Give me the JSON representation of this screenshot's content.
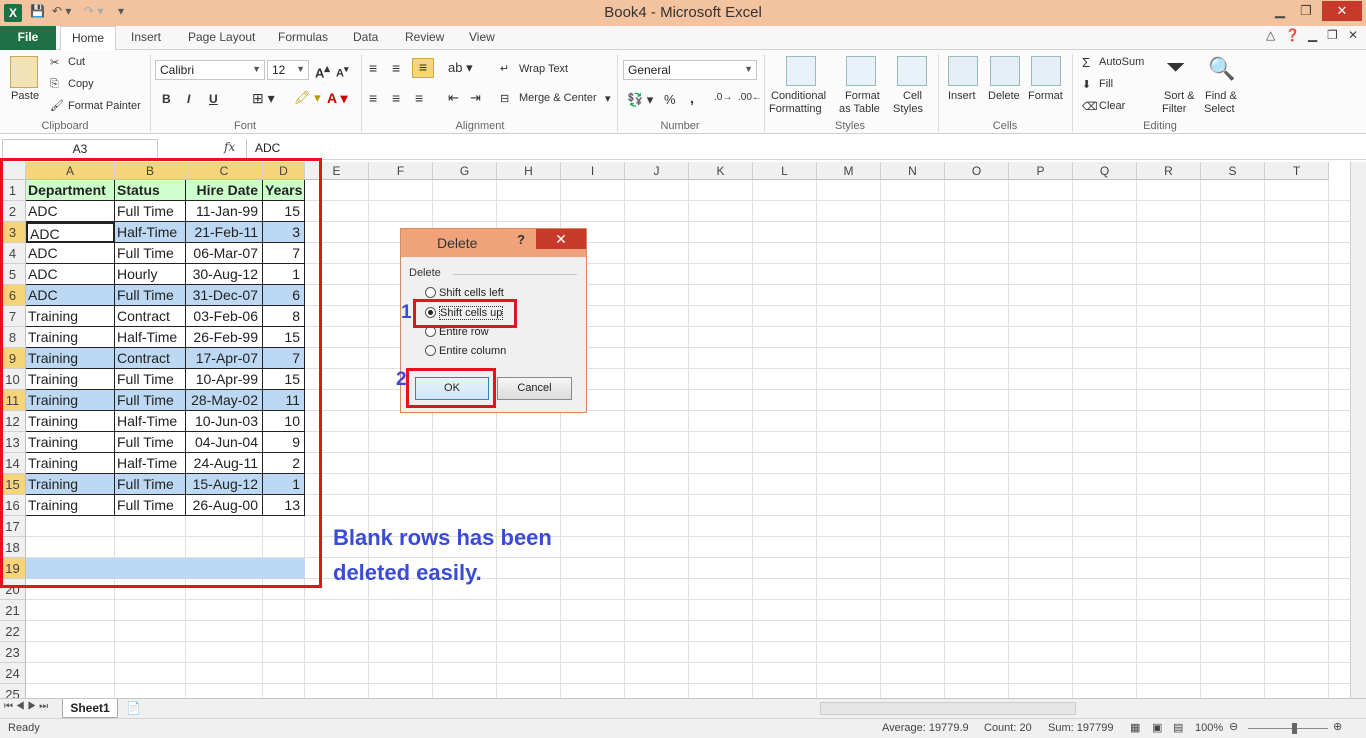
{
  "window": {
    "title": "Book4 -  Microsoft Excel"
  },
  "tabs": [
    "File",
    "Home",
    "Insert",
    "Page Layout",
    "Formulas",
    "Data",
    "Review",
    "View"
  ],
  "ribbon": {
    "clipboard": {
      "paste": "Paste",
      "cut": "Cut",
      "copy": "Copy",
      "format_painter": "Format Painter",
      "label": "Clipboard"
    },
    "font": {
      "name": "Calibri",
      "size": "12",
      "bold": "B",
      "italic": "I",
      "underline": "U",
      "label": "Font"
    },
    "alignment": {
      "wrap": "Wrap Text",
      "merge": "Merge & Center",
      "label": "Alignment"
    },
    "number": {
      "format": "General",
      "percent": "%",
      "comma": ",",
      "label": "Number"
    },
    "styles": {
      "conditional": "Conditional",
      "conditional2": "Formatting",
      "format_table": "Format",
      "format_table2": "as Table",
      "cell_styles": "Cell",
      "cell_styles2": "Styles",
      "label": "Styles"
    },
    "cells": {
      "insert": "Insert",
      "delete": "Delete",
      "format": "Format",
      "label": "Cells"
    },
    "editing": {
      "autosum": "AutoSum",
      "fill": "Fill",
      "clear": "Clear",
      "sort": "Sort &",
      "sort2": "Filter",
      "find": "Find &",
      "find2": "Select",
      "label": "Editing"
    }
  },
  "formula_bar": {
    "name_box": "A3",
    "fx": "fx",
    "content": "ADC"
  },
  "columns": [
    "A",
    "B",
    "C",
    "D",
    "E",
    "F",
    "G",
    "H",
    "I",
    "J",
    "K",
    "L",
    "M",
    "N",
    "O",
    "P",
    "Q",
    "R",
    "S",
    "T"
  ],
  "rows": [
    "1",
    "2",
    "3",
    "4",
    "5",
    "6",
    "7",
    "8",
    "9",
    "10",
    "11",
    "12",
    "13",
    "14",
    "15",
    "16",
    "17",
    "18",
    "19",
    "20",
    "21",
    "22",
    "23",
    "24",
    "25"
  ],
  "table": {
    "headers": [
      "Department",
      "Status",
      "Hire Date",
      "Years"
    ],
    "rows": [
      [
        "ADC",
        "Full Time",
        "11-Jan-99",
        "15"
      ],
      [
        "ADC",
        "Half-Time",
        "21-Feb-11",
        "3"
      ],
      [
        "ADC",
        "Full Time",
        "06-Mar-07",
        "7"
      ],
      [
        "ADC",
        "Hourly",
        "30-Aug-12",
        "1"
      ],
      [
        "ADC",
        "Full Time",
        "31-Dec-07",
        "6"
      ],
      [
        "Training",
        "Contract",
        "03-Feb-06",
        "8"
      ],
      [
        "Training",
        "Half-Time",
        "26-Feb-99",
        "15"
      ],
      [
        "Training",
        "Contract",
        "17-Apr-07",
        "7"
      ],
      [
        "Training",
        "Full Time",
        "10-Apr-99",
        "15"
      ],
      [
        "Training",
        "Full Time",
        "28-May-02",
        "11"
      ],
      [
        "Training",
        "Half-Time",
        "10-Jun-03",
        "10"
      ],
      [
        "Training",
        "Full Time",
        "04-Jun-04",
        "9"
      ],
      [
        "Training",
        "Half-Time",
        "24-Aug-11",
        "2"
      ],
      [
        "Training",
        "Full Time",
        "15-Aug-12",
        "1"
      ],
      [
        "Training",
        "Full Time",
        "26-Aug-00",
        "13"
      ]
    ]
  },
  "dialog": {
    "title": "Delete",
    "help": "?",
    "close": "✕",
    "group_label": "Delete",
    "options": [
      "Shift cells left",
      "Shift cells up",
      "Entire row",
      "Entire column"
    ],
    "selected": "Shift cells up",
    "ok": "OK",
    "cancel": "Cancel"
  },
  "annotations": {
    "step1": "1",
    "step2": "2",
    "message_line1": "Blank rows has been",
    "message_line2": "deleted easily."
  },
  "sheet_tabs": [
    "Sheet1"
  ],
  "status": {
    "ready": "Ready",
    "average": "Average: 19779.9",
    "count": "Count: 20",
    "sum": "Sum: 197799",
    "zoom": "100%"
  },
  "colors": {
    "file_tab": "#1e7145",
    "title_bar": "#f3c29f",
    "header_fill": "#ccffcc",
    "highlight": "#bcd8f2",
    "red_box": "#e2141f",
    "annotation": "#3a4bd6"
  }
}
